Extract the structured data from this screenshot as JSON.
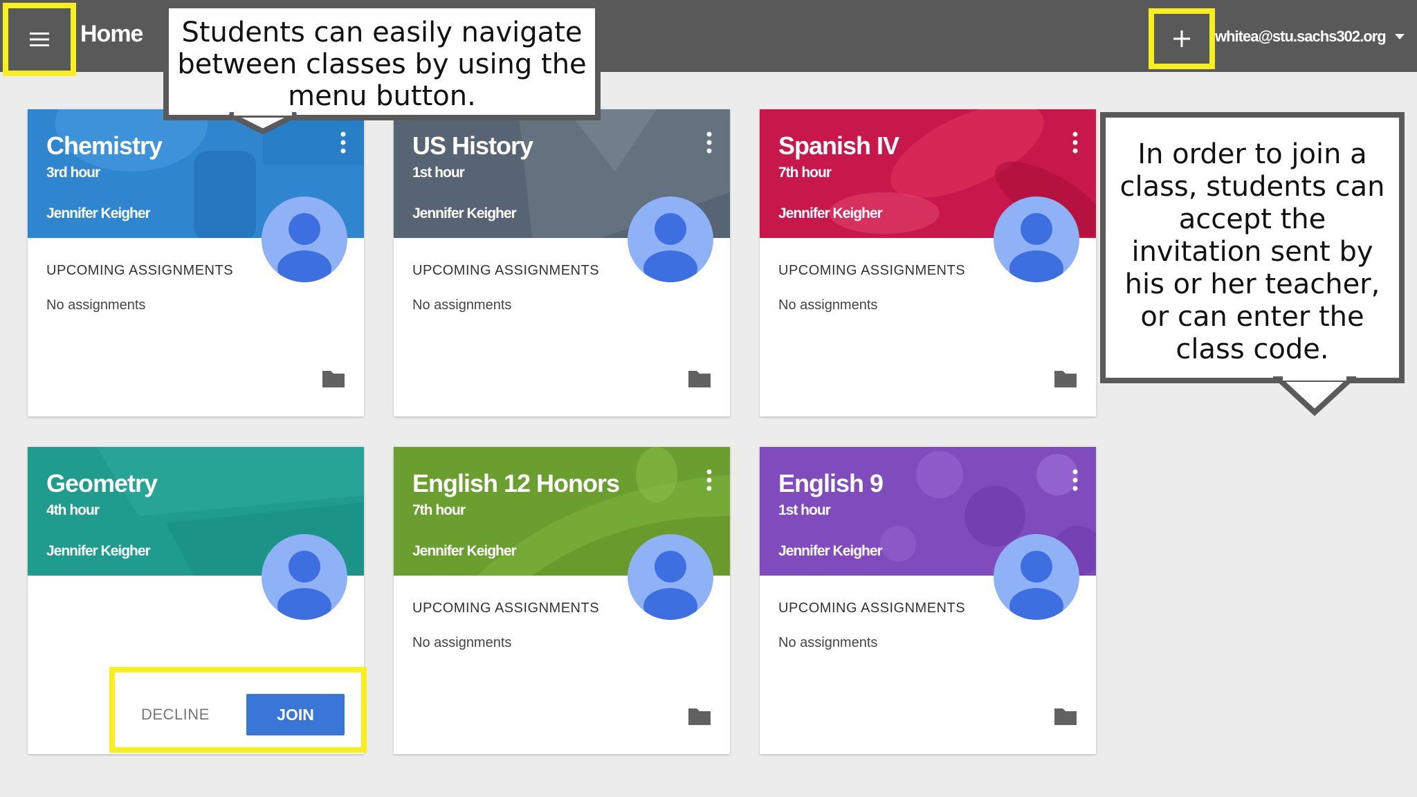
{
  "topbar": {
    "title": "Home",
    "account_email": "whitea@stu.sachs302.org",
    "menu_icon": "hamburger-menu-icon",
    "add_icon": "plus-icon"
  },
  "callouts": {
    "menu_note": "Students can easily navigate between classes by using the menu button.",
    "join_note": "In order to join a class, students can accept the invitation sent by his or her teacher, or can enter the class code."
  },
  "colors": {
    "topbar": "#595959",
    "highlight": "#f7ef1f",
    "join_button": "#3a75d8",
    "avatar": "#8fb2f7",
    "avatar_figure": "#3d6fe0"
  },
  "cards": [
    {
      "title": "Chemistry",
      "section": "3rd hour",
      "teacher": "Jennifer Keigher",
      "upcoming_label": "UPCOMING ASSIGNMENTS",
      "assignments": "No assignments",
      "color": "#2f86cf",
      "state": "enrolled"
    },
    {
      "title": "US History",
      "section": "1st hour",
      "teacher": "Jennifer Keigher",
      "upcoming_label": "UPCOMING ASSIGNMENTS",
      "assignments": "No assignments",
      "color": "#566473",
      "state": "enrolled"
    },
    {
      "title": "Spanish IV",
      "section": "7th hour",
      "teacher": "Jennifer Keigher",
      "upcoming_label": "UPCOMING ASSIGNMENTS",
      "assignments": "No assignments",
      "color": "#c8174a",
      "state": "enrolled"
    },
    {
      "title": "Geometry",
      "section": "4th hour",
      "teacher": "Jennifer Keigher",
      "color": "#1f9c8e",
      "state": "invited",
      "decline_label": "DECLINE",
      "join_label": "JOIN"
    },
    {
      "title": "English 12 Honors",
      "section": "7th hour",
      "teacher": "Jennifer Keigher",
      "upcoming_label": "UPCOMING ASSIGNMENTS",
      "assignments": "No assignments",
      "color": "#6a9e2e",
      "state": "enrolled"
    },
    {
      "title": "English 9",
      "section": "1st hour",
      "teacher": "Jennifer Keigher",
      "upcoming_label": "UPCOMING ASSIGNMENTS",
      "assignments": "No assignments",
      "color": "#7f4bbd",
      "state": "enrolled"
    }
  ]
}
